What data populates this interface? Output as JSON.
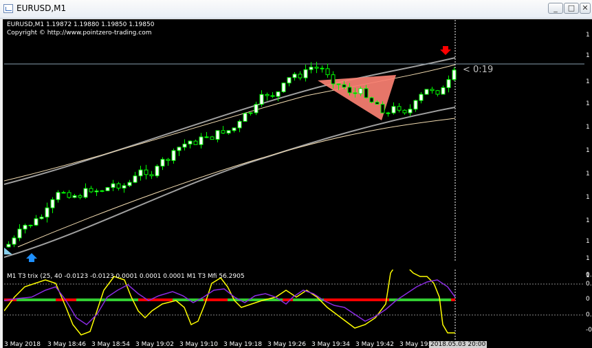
{
  "window": {
    "title": "EURUSD,M1",
    "minimize_label": "_",
    "restore_label": "□",
    "close_label": "✕"
  },
  "header": {
    "symbol_line": "EURUSD,M1  1.19872 1.19880 1.19850 1.19850",
    "copyright": "Copyright © http://www.pointzero-trading.com"
  },
  "countdown": "< 0:19",
  "indicator_line": "M1 T3 trix (25, 40  -0.0123 -0.0123 0.0001 0.0001 0.0001  M1  T3 Mfi  56.2905",
  "price_axis_labels": [
    "1",
    "1",
    "1",
    "1",
    "1",
    "1",
    "1",
    "1",
    "1",
    "1",
    "1",
    "1"
  ],
  "sub_axis_labels": [
    "0.",
    "0.",
    "0",
    "0.",
    "-0."
  ],
  "time_axis_labels": [
    "3 May 2018",
    "3 May 18:46",
    "3 May 18:54",
    "3 May 19:02",
    "3 May 19:10",
    "3 May 19:18",
    "3 May 19:26",
    "3 May 19:34",
    "3 May 19:42",
    "3 May 19:",
    "2018.05.03 20:00"
  ],
  "colors": {
    "background": "#000000",
    "bull_candle": "#ffffff",
    "bear_candle": "#000000",
    "candle_wick": "#00ff00",
    "channel": "#a0a0a0",
    "thin_band": "#f5deb3",
    "triangle": "#fa8072",
    "trix_yellow": "#ffff00",
    "mfi_purple": "#8a2be2",
    "zero_green": "#32cd32",
    "zero_red": "#ff0000",
    "arrow_up": "#1e90ff",
    "arrow_down": "#ff0000"
  },
  "icons": {
    "buy_arrow": "up-arrow-icon",
    "sell_arrow": "down-arrow-icon",
    "window_icon": "chart-window-icon"
  }
}
